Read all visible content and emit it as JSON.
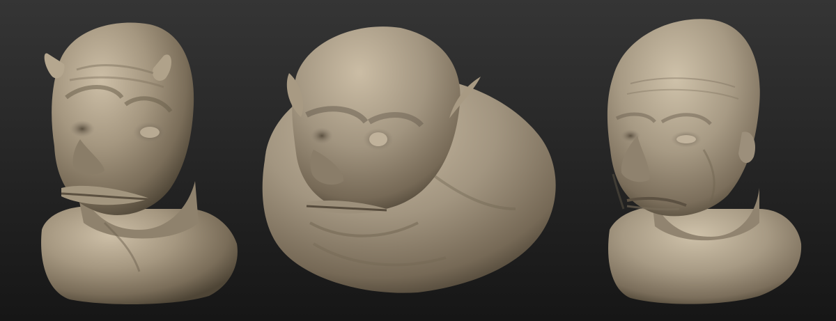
{
  "scene": {
    "background_color": "#1e1e1e",
    "sculpt_material_color": "#9c8f79",
    "sculpt_highlight_color": "#c6b9a2",
    "sculpt_shadow_color": "#5c5140"
  },
  "busts": [
    {
      "subject": "horned-alien-bust"
    },
    {
      "subject": "orc-bust"
    },
    {
      "subject": "elderly-man-bust"
    }
  ]
}
